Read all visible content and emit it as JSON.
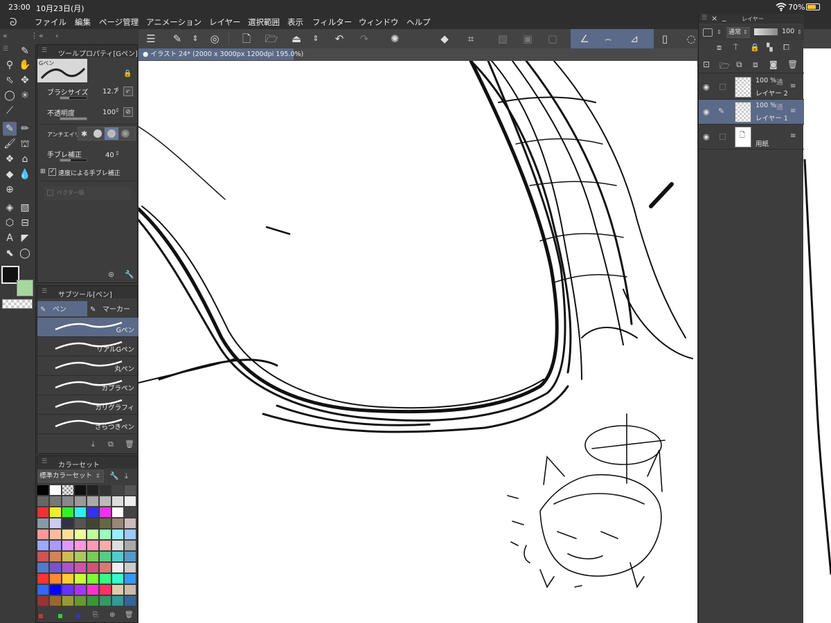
{
  "status": {
    "time": "23:00",
    "date": "10月23日(月)",
    "battery": "70%"
  },
  "menu": [
    "ファイル",
    "編集",
    "ページ管理",
    "アニメーション",
    "レイヤー",
    "選択範囲",
    "表示",
    "フィルター",
    "ウィンドウ",
    "ヘルプ"
  ],
  "tool_property": {
    "title": "ツールプロパティ[Gペン]",
    "brush_name": "Gペン",
    "brush_size_label": "ブラシサイズ",
    "brush_size_value": "12.7",
    "opacity_label": "不透明度",
    "opacity_value": "100",
    "opacity_level": 1.0,
    "brush_size_level": 0.35,
    "antialias_label": "アンチエイリ",
    "stabilization_label": "手ブレ補正",
    "stabilization_value": "40",
    "stabilization_level": 0.4,
    "speed_stabilization_label": "速度による手ブレ補正",
    "vector_label": "ベクター吸"
  },
  "sub_tool": {
    "title": "サブツール[ペン]",
    "tab_pen": "ペン",
    "tab_marker": "マーカー",
    "brushes": [
      "Gペン",
      "リアルGペン",
      "丸ペン",
      "カブラペン",
      "カリグラフィ",
      "ざらつきペン"
    ],
    "selected_index": 0
  },
  "color_set": {
    "title": "カラーセット",
    "preset": "標準カラーセット"
  },
  "canvas": {
    "tab_label": "イラスト 24* (2000 x 3000px 1200dpi 195.0%)"
  },
  "layer_panel": {
    "title": "レイヤー",
    "blend_mode": "通常",
    "opacity": "100",
    "layers": [
      {
        "percent": "100 %",
        "mode": "通",
        "name": "レイヤー 2",
        "selected": false
      },
      {
        "percent": "100 %",
        "mode": "通",
        "name": "レイヤー 1",
        "selected": true
      },
      {
        "percent": "",
        "mode": "",
        "name": "用紙",
        "selected": false
      }
    ]
  },
  "colors": {
    "accent": "#5a6a88",
    "main_color": "#111111",
    "sub_color": "#a6d89e",
    "panel_bg": "#3d3d3d"
  }
}
